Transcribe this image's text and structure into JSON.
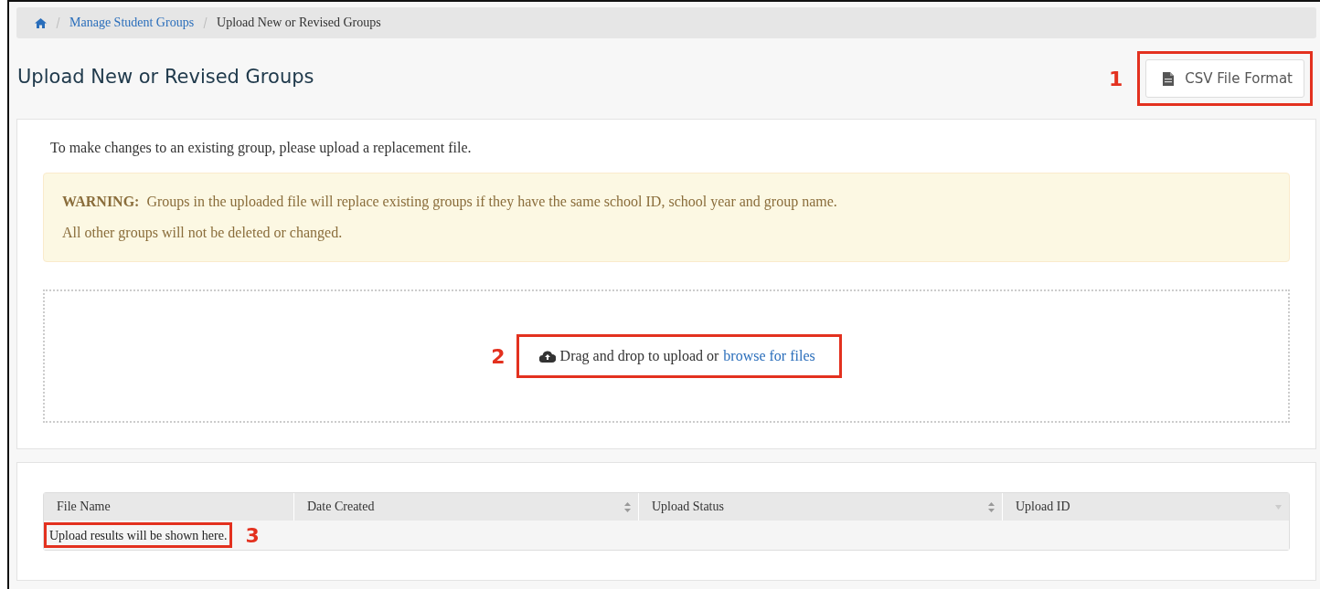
{
  "breadcrumb": [
    {
      "label": "Manage Student Groups",
      "kind": "link"
    },
    {
      "label": "Upload New or Revised Groups",
      "kind": "current"
    }
  ],
  "page_title": "Upload New or Revised Groups",
  "csv_button": {
    "label": "CSV File Format",
    "callout": "1"
  },
  "intro": "To make changes to an existing group, please upload a replacement file.",
  "warning": {
    "lines": [
      "**WARNING:**  Groups in the uploaded file will replace existing groups if they have the same school ID, school year and group name.",
      "All other groups will not be deleted or changed."
    ]
  },
  "dropzone": {
    "text": "Drag and drop to upload or",
    "link": "browse for files",
    "callout": "2"
  },
  "table": {
    "columns": [
      {
        "label": "File Name",
        "kind": "plain"
      },
      {
        "label": "Date Created",
        "kind": "sortable"
      },
      {
        "label": "Upload Status",
        "kind": "sortable"
      },
      {
        "label": "Upload ID",
        "kind": "sorted"
      }
    ],
    "empty_message": "Upload results will be shown here.",
    "callout": "3"
  }
}
